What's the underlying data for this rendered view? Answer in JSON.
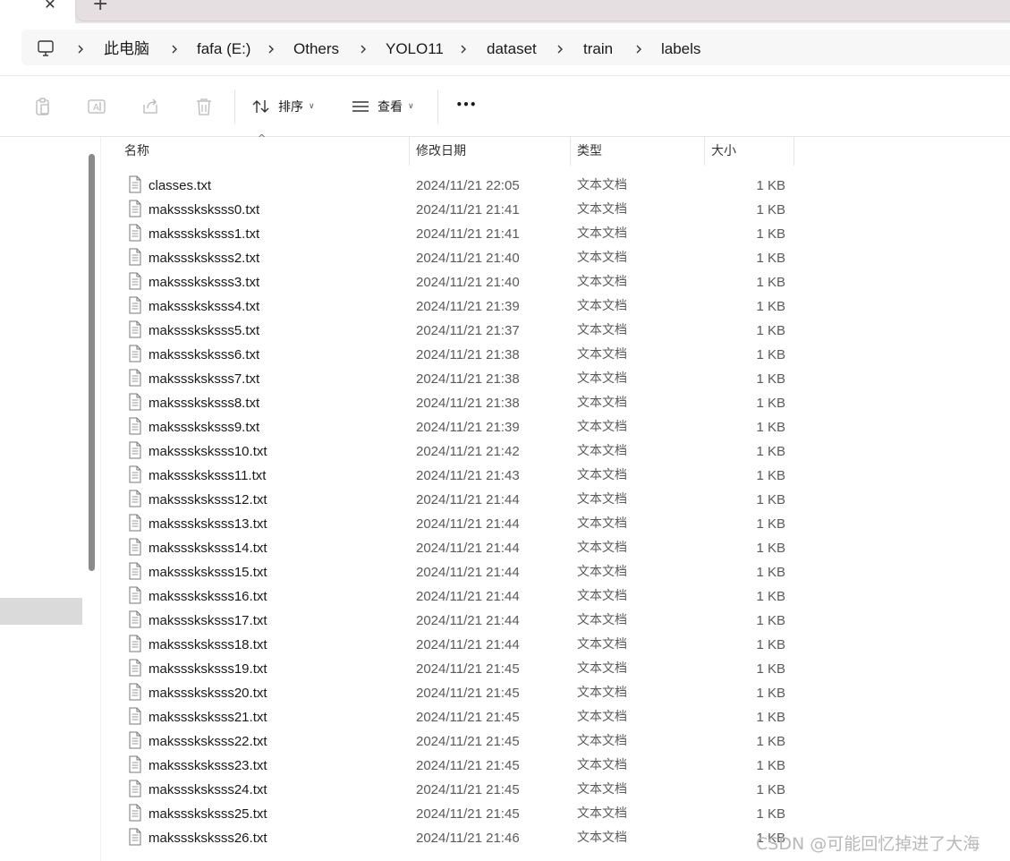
{
  "tabs": {
    "close_glyph": "✕",
    "new_tab_glyph": "+"
  },
  "breadcrumb": {
    "icon": "computer-icon",
    "items": [
      "此电脑",
      "fafa (E:)",
      "Others",
      "YOLO11",
      "dataset",
      "train",
      "labels"
    ]
  },
  "toolbar": {
    "icons": [
      "paste-icon",
      "rename-icon",
      "share-icon",
      "delete-icon"
    ],
    "sort_label": "排序",
    "view_label": "查看",
    "more_glyph": "•••"
  },
  "columns": {
    "name": "名称",
    "date": "修改日期",
    "type": "类型",
    "size": "大小"
  },
  "files": [
    {
      "name": "classes.txt",
      "date": "2024/11/21 22:05",
      "type": "文本文档",
      "size": "1 KB"
    },
    {
      "name": "maksssksksss0.txt",
      "date": "2024/11/21 21:41",
      "type": "文本文档",
      "size": "1 KB"
    },
    {
      "name": "maksssksksss1.txt",
      "date": "2024/11/21 21:41",
      "type": "文本文档",
      "size": "1 KB"
    },
    {
      "name": "maksssksksss2.txt",
      "date": "2024/11/21 21:40",
      "type": "文本文档",
      "size": "1 KB"
    },
    {
      "name": "maksssksksss3.txt",
      "date": "2024/11/21 21:40",
      "type": "文本文档",
      "size": "1 KB"
    },
    {
      "name": "maksssksksss4.txt",
      "date": "2024/11/21 21:39",
      "type": "文本文档",
      "size": "1 KB"
    },
    {
      "name": "maksssksksss5.txt",
      "date": "2024/11/21 21:37",
      "type": "文本文档",
      "size": "1 KB"
    },
    {
      "name": "maksssksksss6.txt",
      "date": "2024/11/21 21:38",
      "type": "文本文档",
      "size": "1 KB"
    },
    {
      "name": "maksssksksss7.txt",
      "date": "2024/11/21 21:38",
      "type": "文本文档",
      "size": "1 KB"
    },
    {
      "name": "maksssksksss8.txt",
      "date": "2024/11/21 21:38",
      "type": "文本文档",
      "size": "1 KB"
    },
    {
      "name": "maksssksksss9.txt",
      "date": "2024/11/21 21:39",
      "type": "文本文档",
      "size": "1 KB"
    },
    {
      "name": "maksssksksss10.txt",
      "date": "2024/11/21 21:42",
      "type": "文本文档",
      "size": "1 KB"
    },
    {
      "name": "maksssksksss11.txt",
      "date": "2024/11/21 21:43",
      "type": "文本文档",
      "size": "1 KB"
    },
    {
      "name": "maksssksksss12.txt",
      "date": "2024/11/21 21:44",
      "type": "文本文档",
      "size": "1 KB"
    },
    {
      "name": "maksssksksss13.txt",
      "date": "2024/11/21 21:44",
      "type": "文本文档",
      "size": "1 KB"
    },
    {
      "name": "maksssksksss14.txt",
      "date": "2024/11/21 21:44",
      "type": "文本文档",
      "size": "1 KB"
    },
    {
      "name": "maksssksksss15.txt",
      "date": "2024/11/21 21:44",
      "type": "文本文档",
      "size": "1 KB"
    },
    {
      "name": "maksssksksss16.txt",
      "date": "2024/11/21 21:44",
      "type": "文本文档",
      "size": "1 KB"
    },
    {
      "name": "maksssksksss17.txt",
      "date": "2024/11/21 21:44",
      "type": "文本文档",
      "size": "1 KB"
    },
    {
      "name": "maksssksksss18.txt",
      "date": "2024/11/21 21:44",
      "type": "文本文档",
      "size": "1 KB"
    },
    {
      "name": "maksssksksss19.txt",
      "date": "2024/11/21 21:45",
      "type": "文本文档",
      "size": "1 KB"
    },
    {
      "name": "maksssksksss20.txt",
      "date": "2024/11/21 21:45",
      "type": "文本文档",
      "size": "1 KB"
    },
    {
      "name": "maksssksksss21.txt",
      "date": "2024/11/21 21:45",
      "type": "文本文档",
      "size": "1 KB"
    },
    {
      "name": "maksssksksss22.txt",
      "date": "2024/11/21 21:45",
      "type": "文本文档",
      "size": "1 KB"
    },
    {
      "name": "maksssksksss23.txt",
      "date": "2024/11/21 21:45",
      "type": "文本文档",
      "size": "1 KB"
    },
    {
      "name": "maksssksksss24.txt",
      "date": "2024/11/21 21:45",
      "type": "文本文档",
      "size": "1 KB"
    },
    {
      "name": "maksssksksss25.txt",
      "date": "2024/11/21 21:45",
      "type": "文本文档",
      "size": "1 KB"
    },
    {
      "name": "maksssksksss26.txt",
      "date": "2024/11/21 21:46",
      "type": "文本文档",
      "size": "1 KB"
    }
  ],
  "watermark": "CSDN @可能回忆掉进了大海",
  "colors": {
    "tabstrip": "#e9e4e6",
    "address_bg": "#f7f7f7",
    "selected_nav": "#dadada",
    "scrollbar": "#8a8a8a"
  }
}
